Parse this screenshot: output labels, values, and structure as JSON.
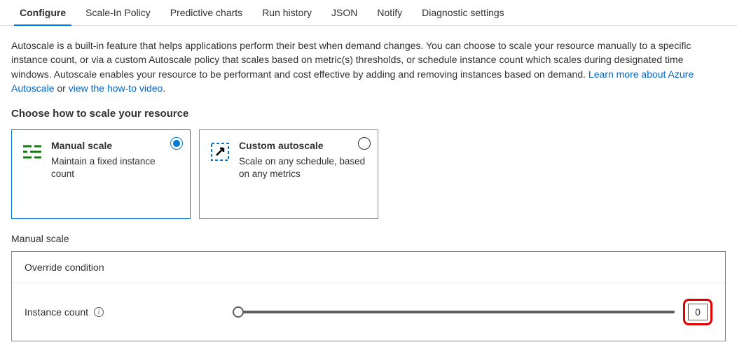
{
  "tabs": [
    {
      "label": "Configure",
      "active": true
    },
    {
      "label": "Scale-In Policy",
      "active": false
    },
    {
      "label": "Predictive charts",
      "active": false
    },
    {
      "label": "Run history",
      "active": false
    },
    {
      "label": "JSON",
      "active": false
    },
    {
      "label": "Notify",
      "active": false
    },
    {
      "label": "Diagnostic settings",
      "active": false
    }
  ],
  "description": {
    "text": "Autoscale is a built-in feature that helps applications perform their best when demand changes. You can choose to scale your resource manually to a specific instance count, or via a custom Autoscale policy that scales based on metric(s) thresholds, or schedule instance count which scales during designated time windows. Autoscale enables your resource to be performant and cost effective by adding and removing instances based on demand. ",
    "link1": "Learn more about Azure Autoscale",
    "mid": " or ",
    "link2": "view the how-to video",
    "end": "."
  },
  "section_title": "Choose how to scale your resource",
  "cards": {
    "manual": {
      "title": "Manual scale",
      "desc": "Maintain a fixed instance count"
    },
    "custom": {
      "title": "Custom autoscale",
      "desc": "Scale on any schedule, based on any metrics"
    }
  },
  "sub_title": "Manual scale",
  "panel": {
    "header": "Override condition",
    "instance_label": "Instance count",
    "instance_value": "0"
  }
}
